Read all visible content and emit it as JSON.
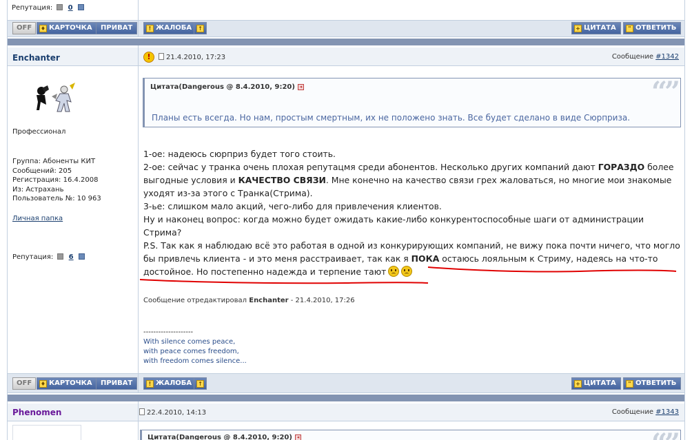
{
  "top": {
    "reputation_label": "Репутация:",
    "reputation_value": "0"
  },
  "buttons": {
    "off": "OFF",
    "card": "КАРТОЧКА",
    "private": "ПРИВАТ",
    "complaint": "ЖАЛОБА",
    "up_glyph": "↑",
    "quote": "ЦИТАТА",
    "reply": "ОТВЕТИТЬ",
    "card_glyph": "♦",
    "complaint_glyph": "!",
    "quote_glyph": "+",
    "reply_glyph": "\""
  },
  "post1": {
    "author": "Enchanter",
    "rank": "Профессионал",
    "group": "Группа: Абоненты КИТ",
    "messages": "Сообщений: 205",
    "registered": "Регистрация: 16.4.2008",
    "from": "Из: Астрахань",
    "user_no": "Пользователь №: 10 963",
    "folder": "Личная папка",
    "reputation_label": "Репутация:",
    "reputation_value": "6",
    "date": "21.4.2010, 17:23",
    "msg_label": "Сообщение",
    "msg_no": "#1342",
    "quote_head": "Цитата(Dangerous @ 8.4.2010, 9:20)",
    "quote_text": "Планы есть всегда. Но нам, простым смертным, их не положено знать. Все будет сделано в виде Сюрприза.",
    "quote_mark": "“”",
    "body": {
      "l1": "1-ое: надеюсь сюрприз будет того стоить.",
      "l2a": "2-ое: сейчас у транка очень плохая репутацмя среди абонентов. Несколько других компаний дают ",
      "l2b": "ГОРАЗДО",
      "l2c": " более выгодные условия и ",
      "l2d": "КАЧЕСТВО СВЯЗИ",
      "l2e": ". Мне конечно на качество связи грех жаловаться, но многие мои знакомые уходят из-за этого с Транка(Стрима).",
      "l3": "3-ье: слишком мало акций, чего-либо для привлечения клиентов.",
      "l4": "Ну и наконец вопрос: когда можно будет ожидать какие-либо конкурентоспособные шаги от администрации Стрима?",
      "l5a": "P.S. Так как я наблюдаю всё это работая в одной из конкурирующих компаний, не вижу пока почти ничего, что могло бы привлечь клиента - и это меня расстраивает, так как я ",
      "l5b": "ПОКА",
      "l5c": " остаюсь лояльным к Стриму, надеясь на что-то достойное. Но постепенно надежда и терпение тают"
    },
    "edited_prefix": "Сообщение отредактировал ",
    "edited_by": "Enchanter",
    "edited_suffix": " - 21.4.2010, 17:26",
    "sig_line": "--------------------",
    "sig1": "With silence comes peace,",
    "sig2": "with peace comes freedom,",
    "sig3": "with freedom comes silence..."
  },
  "post2": {
    "author": "Phenomen",
    "date": "22.4.2010, 14:13",
    "msg_label": "Сообщение",
    "msg_no": "#1343",
    "quote_head": "Цитата(Dangerous @ 8.4.2010, 9:20)"
  },
  "colors": {
    "underline": "#e00000",
    "accent": "#4565a0",
    "strip": "#8394b2"
  }
}
